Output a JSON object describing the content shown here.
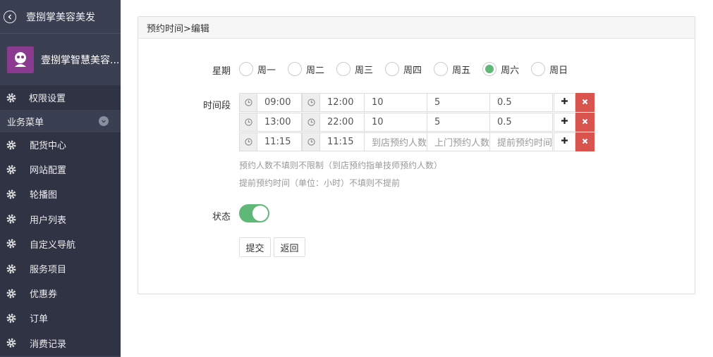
{
  "sidebar": {
    "app_title": "壹捌掌美容美发",
    "user_name": "壹捌掌智慧美容...",
    "top_item": "权限设置",
    "group_label": "业务菜单",
    "items": [
      "配货中心",
      "网站配置",
      "轮播图",
      "用户列表",
      "自定义导航",
      "服务项目",
      "优惠券",
      "订单",
      "消费记录"
    ]
  },
  "panel": {
    "title": "预约时间>编辑",
    "weekday_label": "星期",
    "weekdays": [
      "周一",
      "周二",
      "周三",
      "周四",
      "周五",
      "周六",
      "周日"
    ],
    "selected_weekday": "周六",
    "time_label": "时间段",
    "slots": [
      {
        "start": "09:00",
        "end": "12:00",
        "store": "10",
        "visit": "5",
        "advance": "0.5"
      },
      {
        "start": "13:00",
        "end": "22:00",
        "store": "10",
        "visit": "5",
        "advance": "0.5"
      },
      {
        "start": "11:15",
        "end": "11:15",
        "store": "",
        "visit": "",
        "advance": ""
      }
    ],
    "placeholders": {
      "store": "到店预约人数",
      "visit": "上门预约人数",
      "advance": "提前预约时间"
    },
    "hint1": "预约人数不填则不限制（到店预约指单技师预约人数）",
    "hint2": "提前预约时间（单位：小时）不填则不提前",
    "status_label": "状态",
    "status_on": true,
    "submit_label": "提交",
    "back_label": "返回"
  },
  "colors": {
    "sidebar_bg": "#3a3f51",
    "accent_green": "#5fb878",
    "delete_red": "#d9534f"
  }
}
